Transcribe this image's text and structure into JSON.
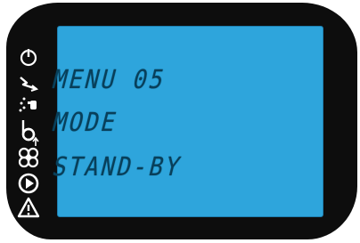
{
  "display": {
    "line1": "MENU 05",
    "line2": "MODE",
    "line3": "STAND-BY"
  },
  "colors": {
    "bezel": "#0d0d0d",
    "screen": "#2ea5dc",
    "segment_text": "#083f5a",
    "icons": "#ffffff"
  },
  "icons": [
    "power-icon",
    "lightning-icon",
    "spray-icon",
    "drop-temperature-icon",
    "fan-icon",
    "arrow-up-icon",
    "play-icon",
    "warning-icon"
  ]
}
